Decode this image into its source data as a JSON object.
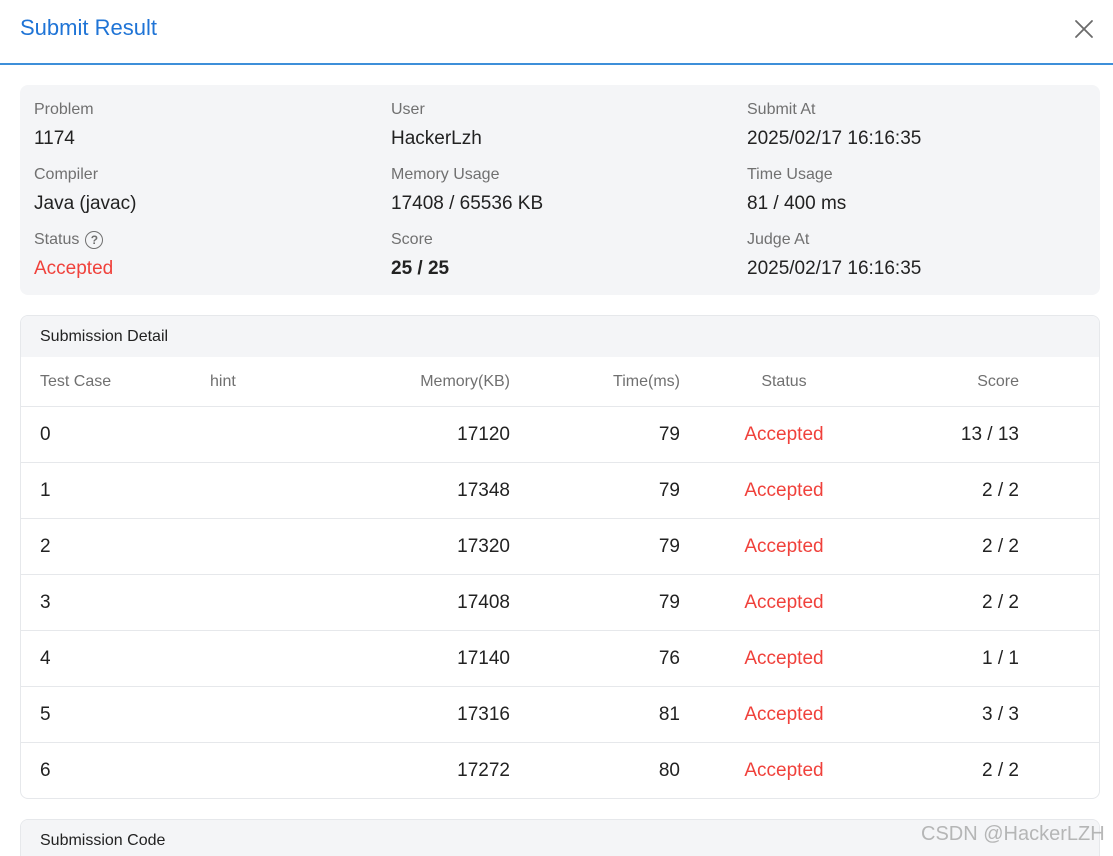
{
  "dialog": {
    "title": "Submit Result"
  },
  "info": {
    "problem": {
      "label": "Problem",
      "value": "1174"
    },
    "user": {
      "label": "User",
      "value": "HackerLzh"
    },
    "submit_at": {
      "label": "Submit At",
      "value": "2025/02/17 16:16:35"
    },
    "compiler": {
      "label": "Compiler",
      "value": "Java (javac)"
    },
    "memory": {
      "label": "Memory Usage",
      "value": "17408 / 65536 KB"
    },
    "time": {
      "label": "Time Usage",
      "value": "81 / 400 ms"
    },
    "status": {
      "label": "Status",
      "value": "Accepted",
      "help_icon": "question-circle-icon"
    },
    "score": {
      "label": "Score",
      "value": "25 / 25"
    },
    "judge_at": {
      "label": "Judge At",
      "value": "2025/02/17 16:16:35"
    }
  },
  "detail": {
    "title": "Submission Detail",
    "columns": {
      "case": "Test Case",
      "hint": "hint",
      "memory": "Memory(KB)",
      "time": "Time(ms)",
      "status": "Status",
      "score": "Score"
    },
    "rows": [
      {
        "case": "0",
        "hint": "",
        "memory": "17120",
        "time": "79",
        "status": "Accepted",
        "score": "13 / 13"
      },
      {
        "case": "1",
        "hint": "",
        "memory": "17348",
        "time": "79",
        "status": "Accepted",
        "score": "2 / 2"
      },
      {
        "case": "2",
        "hint": "",
        "memory": "17320",
        "time": "79",
        "status": "Accepted",
        "score": "2 / 2"
      },
      {
        "case": "3",
        "hint": "",
        "memory": "17408",
        "time": "79",
        "status": "Accepted",
        "score": "2 / 2"
      },
      {
        "case": "4",
        "hint": "",
        "memory": "17140",
        "time": "76",
        "status": "Accepted",
        "score": "1 / 1"
      },
      {
        "case": "5",
        "hint": "",
        "memory": "17316",
        "time": "81",
        "status": "Accepted",
        "score": "3 / 3"
      },
      {
        "case": "6",
        "hint": "",
        "memory": "17272",
        "time": "80",
        "status": "Accepted",
        "score": "2 / 2"
      }
    ]
  },
  "code": {
    "title": "Submission Code"
  },
  "watermark": "CSDN @HackerLZH",
  "colors": {
    "accent": "#1f74d6",
    "accepted": "#f0413b",
    "panel_bg": "#f4f5f7"
  }
}
